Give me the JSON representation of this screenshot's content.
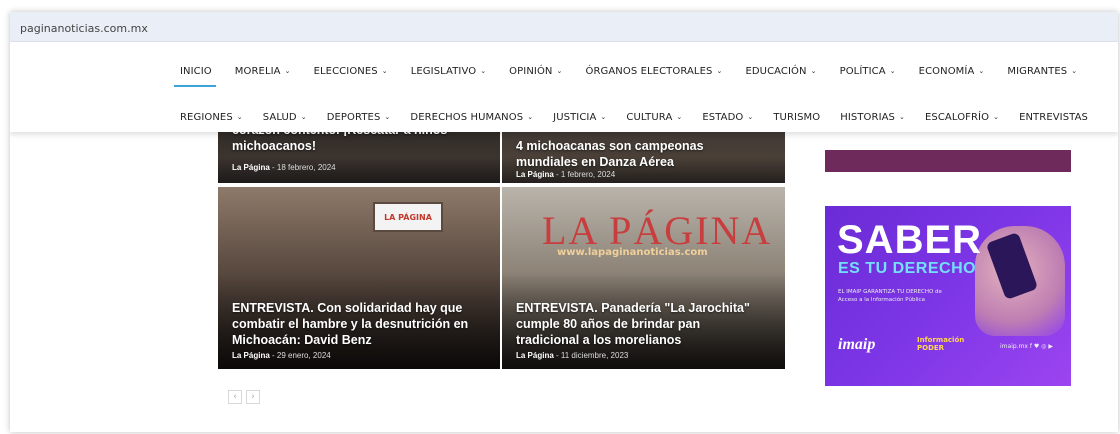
{
  "browser": {
    "url": "paginanoticias.com.mx"
  },
  "nav": {
    "row1": [
      {
        "label": "INICIO",
        "chevron": false,
        "active": true
      },
      {
        "label": "MORELIA",
        "chevron": true
      },
      {
        "label": "ELECCIONES",
        "chevron": true
      },
      {
        "label": "LEGISLATIVO",
        "chevron": true
      },
      {
        "label": "OPINIÓN",
        "chevron": true
      },
      {
        "label": "ÓRGANOS ELECTORALES",
        "chevron": true
      },
      {
        "label": "EDUCACIÓN",
        "chevron": true
      },
      {
        "label": "POLÍTICA",
        "chevron": true
      },
      {
        "label": "ECONOMÍA",
        "chevron": true
      },
      {
        "label": "MIGRANTES",
        "chevron": true
      }
    ],
    "row2": [
      {
        "label": "REGIONES",
        "chevron": true
      },
      {
        "label": "SALUD",
        "chevron": true
      },
      {
        "label": "DEPORTES",
        "chevron": true
      },
      {
        "label": "DERECHOS HUMANOS",
        "chevron": true
      },
      {
        "label": "JUSTICIA",
        "chevron": true
      },
      {
        "label": "CULTURA",
        "chevron": true
      },
      {
        "label": "ESTADO",
        "chevron": true
      },
      {
        "label": "TURISMO",
        "chevron": false
      },
      {
        "label": "HISTORIAS",
        "chevron": true
      },
      {
        "label": "ESCALOFRÍO",
        "chevron": true
      },
      {
        "label": "ENTREVISTAS",
        "chevron": false
      }
    ],
    "chevron_glyph": "⌄"
  },
  "cards": [
    {
      "title_line1": "corazón contento. ¡Rescatar a niños",
      "title_line2": "michoacanos!",
      "author": "La Página",
      "date": "18 febrero, 2024"
    },
    {
      "title_line1": "4 michoacanas son campeonas",
      "title_line2": "mundiales en Danza Aérea",
      "author": "La Página",
      "date": "1 febrero, 2024"
    },
    {
      "title_line1": "ENTREVISTA. Con solidaridad hay que",
      "title_line2": "combatir el hambre y la desnutrición en",
      "title_line3": "Michoacán: David Benz",
      "author": "La Página",
      "date": "29 enero, 2024",
      "sign": "LA PÁGINA"
    },
    {
      "title_line1": "ENTREVISTA. Panadería \"La Jarochita\"",
      "title_line2": "cumple 80 años de brindar pan",
      "title_line3": "tradicional a los morelianos",
      "author": "La Página",
      "date": "11 diciembre, 2023",
      "brand": "LA PÁGINA",
      "brand_url": "www.lapaginanoticias.com"
    }
  ],
  "pager": {
    "prev": "‹",
    "next": "›"
  },
  "ads": {
    "main": {
      "headline": "SABER",
      "subheadline": "ES TU DERECHO",
      "body": "EL IMAIP GARANTIZA TU DERECHO de Acceso a la Información Pública",
      "logo": "imaip",
      "partner_line1": "Información",
      "partner_line2": "PODER",
      "social": "imaip.mx  f  ♥  ◎  ▶"
    }
  },
  "colors": {
    "accent": "#3da3dc",
    "ad_pink": "#e0127b",
    "ad_purple": "#7d36e6"
  }
}
